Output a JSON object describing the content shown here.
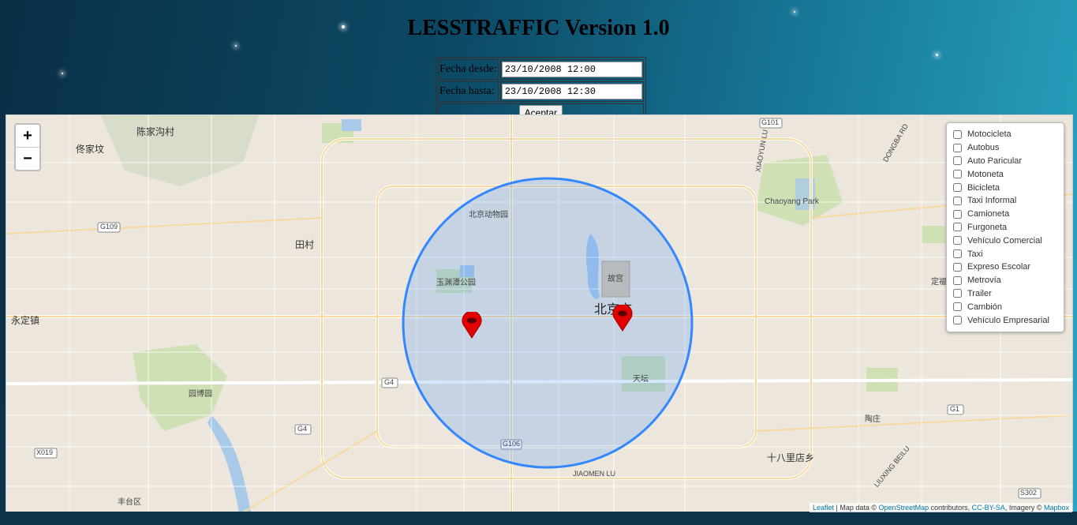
{
  "header": {
    "title": "LESSTRAFFIC Version 1.0"
  },
  "form": {
    "from_label": "Fecha desde:",
    "from_value": "23/10/2008 12:00",
    "to_label": "Fecha hasta:",
    "to_value": "23/10/2008 12:30",
    "accept_label": "Aceptar"
  },
  "map": {
    "zoom_in": "+",
    "zoom_out": "−",
    "circle_color": "#3388ff",
    "marker_color": "#e30000",
    "labels": {
      "beijing": "北京市",
      "yongding": "永定镇",
      "gugong": "故宫",
      "tiantan": "天坛",
      "chaoyang_park": "Chaoyang Park",
      "tiancun": "田村",
      "chenjiagou": "陈家沟村",
      "tuanjiahu": "佟家坟",
      "shibalidian": "十八里店乡",
      "taozhuang": "陶庄",
      "dingfuzhuang": "定福庄",
      "fengtai": "丰台区",
      "yuanboyuan": "园博园",
      "xiaowaji": "北京动物园",
      "yuyuantan": "玉渊潭公园",
      "g109": "G109",
      "g4": "G4",
      "g106": "G106",
      "g101": "G101",
      "g1": "G1",
      "s302": "S302",
      "x019": "X019",
      "jiaomen": "JIAOMEN LU",
      "xiaoyun": "XIAOYUN LU",
      "liuxing": "LIUXING BEILU",
      "dongba": "DONGBA RD"
    },
    "attribution": {
      "leaflet": "Leaflet",
      "mid": " | Map data © ",
      "osm": "OpenStreetMap",
      "contrib": " contributors, ",
      "cc": "CC-BY-SA",
      "imagery": ", Imagery © ",
      "mapbox": "Mapbox"
    }
  },
  "layers": [
    "Motocicleta",
    "Autobus",
    "Auto Paricular",
    "Motoneta",
    "Bicicleta",
    "Taxi Informal",
    "Camioneta",
    "Furgoneta",
    "Vehículo Comercial",
    "Taxi",
    "Expreso Escolar",
    "Metrovía",
    "Trailer",
    "Cambión",
    "Vehículo Empresarial"
  ]
}
